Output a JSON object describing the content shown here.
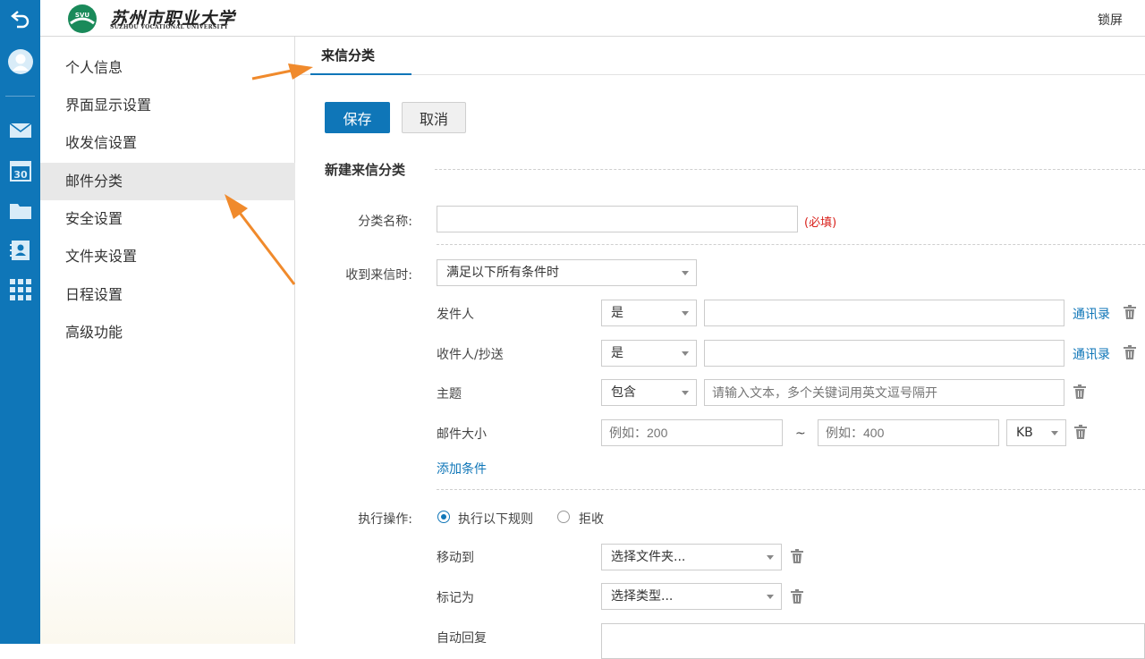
{
  "rail": {
    "icons": [
      "back-icon",
      "user-avatar-icon",
      "mail-icon",
      "calendar-icon",
      "folder-icon",
      "contacts-icon",
      "apps-grid-icon"
    ],
    "calendar_day": "30",
    "color": "#0f76b8"
  },
  "header": {
    "logo_name": "苏州市职业大学",
    "logo_en": "SUZHOU VOCATIONAL UNIVERSITY",
    "logo_badge": "SVU",
    "lock_label": "锁屏"
  },
  "sidebar": {
    "items": [
      {
        "label": "个人信息"
      },
      {
        "label": "界面显示设置"
      },
      {
        "label": "收发信设置"
      },
      {
        "label": "邮件分类",
        "active": true
      },
      {
        "label": "安全设置"
      },
      {
        "label": "文件夹设置"
      },
      {
        "label": "日程设置"
      },
      {
        "label": "高级功能"
      }
    ]
  },
  "tab": {
    "label": "来信分类"
  },
  "toolbar": {
    "save_label": "保存",
    "cancel_label": "取消"
  },
  "form": {
    "section_title": "新建来信分类",
    "name_label": "分类名称:",
    "name_value": "",
    "required_note": "(必填)",
    "condition_label": "收到来信时:",
    "condition_value": "满足以下所有条件时",
    "rows": {
      "sender": {
        "label": "发件人",
        "op": "是",
        "value": "",
        "link": "通讯录"
      },
      "recipient": {
        "label": "收件人/抄送",
        "op": "是",
        "value": "",
        "link": "通讯录"
      },
      "subject": {
        "label": "主题",
        "op": "包含",
        "placeholder": "请输入文本，多个关键词用英文逗号隔开"
      },
      "size": {
        "label": "邮件大小",
        "min_placeholder": "例如：200",
        "separator": "~",
        "max_placeholder": "例如：400",
        "unit": "KB"
      }
    },
    "add_condition": "添加条件",
    "action_label": "执行操作:",
    "action_options": [
      {
        "label": "执行以下规则",
        "selected": true
      },
      {
        "label": "拒收",
        "selected": false
      }
    ],
    "move_to": {
      "label": "移动到",
      "value": "选择文件夹..."
    },
    "mark_as": {
      "label": "标记为",
      "value": "选择类型..."
    },
    "auto_reply": {
      "label": "自动回复"
    }
  },
  "accent_color": "#0f76b8",
  "annotation_color": "#f08a2c"
}
